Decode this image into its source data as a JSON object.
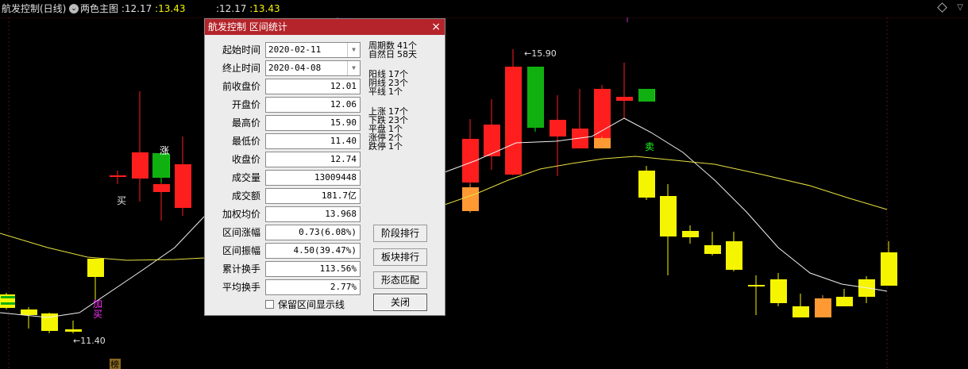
{
  "header": {
    "title": "航发控制(日线)",
    "indicator_label": "两色主图",
    "group1": [
      ":12.17",
      ":13.43"
    ],
    "group2": [
      ":12.17",
      ":13.43"
    ]
  },
  "chart": {
    "up_color": "#ff1e1e",
    "down_color": "#00e000",
    "flat_color": "#f5f500",
    "highlight_color": "#ff9933",
    "ma_color": "#f0f0f0",
    "ma2_color": "#e8e040",
    "high_label": "15.90",
    "low_label": "11.40",
    "signals": [
      {
        "id": "buy-1",
        "text": "买"
      },
      {
        "id": "add-buy",
        "text": "加买"
      },
      {
        "id": "rise-1",
        "text": "涨"
      },
      {
        "id": "sell-1",
        "text": "卖"
      }
    ],
    "bottom_tag": "榜"
  },
  "dialog": {
    "title": "航发控制 区间统计",
    "close_glyph": "×",
    "fields": [
      {
        "label": "起始时间",
        "value": "2020-02-11",
        "type": "date"
      },
      {
        "label": "终止时间",
        "value": "2020-04-08",
        "type": "date"
      },
      {
        "label": "前收盘价",
        "value": "12.01"
      },
      {
        "label": "开盘价",
        "value": "12.06"
      },
      {
        "label": "最高价",
        "value": "15.90"
      },
      {
        "label": "最低价",
        "value": "11.40"
      },
      {
        "label": "收盘价",
        "value": "12.74"
      },
      {
        "label": "成交量",
        "value": "13009448"
      },
      {
        "label": "成交额",
        "value": "181.7亿"
      },
      {
        "label": "加权均价",
        "value": "13.968"
      },
      {
        "label": "区间涨幅",
        "value": "0.73(6.08%)"
      },
      {
        "label": "区间振幅",
        "value": "4.50(39.47%)"
      },
      {
        "label": "累计换手",
        "value": "113.56%"
      },
      {
        "label": "平均换手",
        "value": "2.77%"
      }
    ],
    "stats": [
      {
        "label": "周期数",
        "value": "41个"
      },
      {
        "label": "自然日",
        "value": "58天"
      },
      {
        "label": "阳线",
        "value": "17个"
      },
      {
        "label": "阴线",
        "value": "23个"
      },
      {
        "label": "平线",
        "value": "1个"
      },
      {
        "label": "上涨",
        "value": "17个"
      },
      {
        "label": "下跌",
        "value": "23个"
      },
      {
        "label": "平盘",
        "value": "1个"
      },
      {
        "label": "涨停",
        "value": "2个"
      },
      {
        "label": "跌停",
        "value": "1个"
      }
    ],
    "buttons": {
      "stage_rank": "阶段排行",
      "sector_rank": "板块排行",
      "pattern_match": "形态匹配",
      "close": "关闭"
    },
    "checkbox_label": "保留区间显示线"
  }
}
